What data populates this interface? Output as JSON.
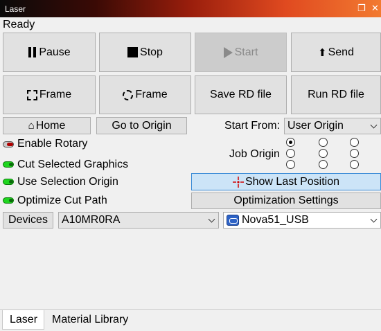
{
  "window": {
    "title": "Laser"
  },
  "status": "Ready",
  "buttons": {
    "pause": "Pause",
    "stop": "Stop",
    "start": "Start",
    "send": "Send",
    "frame_square": "Frame",
    "frame_circle": "Frame",
    "save_rd": "Save RD file",
    "run_rd": "Run RD file",
    "home": "Home",
    "go_to_origin": "Go to Origin",
    "show_last_position": "Show Last Position",
    "optimization_settings": "Optimization Settings",
    "devices": "Devices"
  },
  "start_from": {
    "label": "Start From:",
    "value": "User Origin"
  },
  "job_origin": {
    "label": "Job Origin",
    "selected_index": 0
  },
  "toggles": [
    {
      "label": "Enable Rotary",
      "state": "off"
    },
    {
      "label": "Cut Selected Graphics",
      "state": "on"
    },
    {
      "label": "Use Selection Origin",
      "state": "on"
    },
    {
      "label": "Optimize Cut Path",
      "state": "on"
    }
  ],
  "device_select": {
    "value": "A10MR0RA"
  },
  "port_select": {
    "value": "Nova51_USB"
  },
  "tabs": [
    {
      "label": "Laser",
      "active": true
    },
    {
      "label": "Material Library",
      "active": false
    }
  ],
  "colors": {
    "toggle_on": "#1fd51f",
    "toggle_off_knob": "#b00000",
    "highlight": "#cce4f7",
    "usb_icon": "#2e63c6"
  }
}
